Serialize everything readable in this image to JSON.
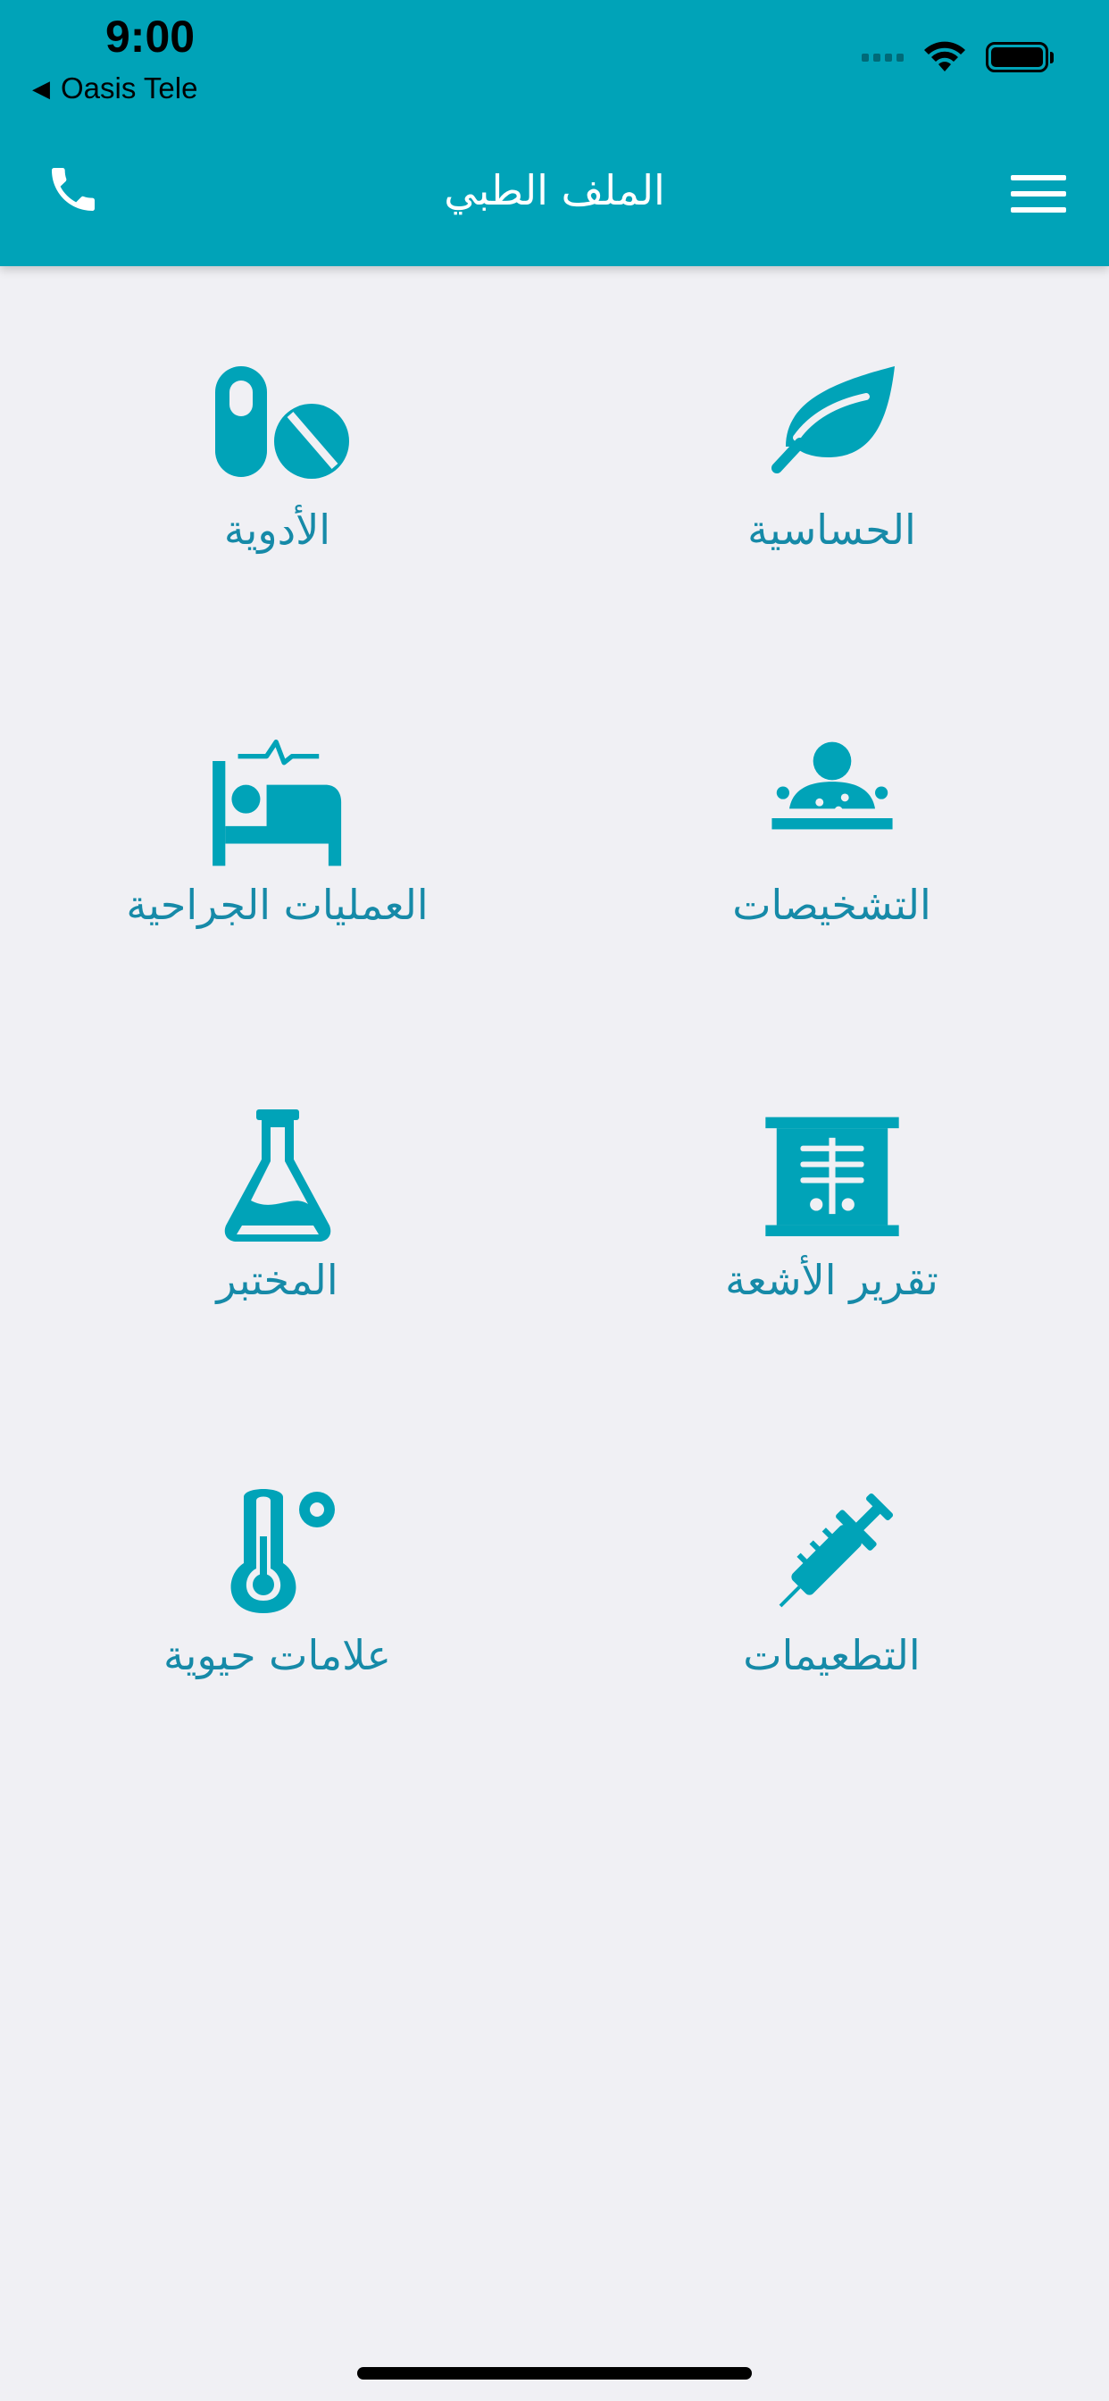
{
  "status_bar": {
    "time": "9:00",
    "back_label": "Oasis Tele"
  },
  "header": {
    "title": "الملف الطبي"
  },
  "grid": {
    "items": [
      {
        "label": "الحساسية",
        "icon": "leaf-icon"
      },
      {
        "label": "الأدوية",
        "icon": "pills-icon"
      },
      {
        "label": "التشخيصات",
        "icon": "diagnosis-icon"
      },
      {
        "label": "العمليات الجراحية",
        "icon": "hospital-bed-icon"
      },
      {
        "label": "تقرير الأشعة",
        "icon": "xray-icon"
      },
      {
        "label": "المختبر",
        "icon": "flask-icon"
      },
      {
        "label": "التطعيمات",
        "icon": "syringe-icon"
      },
      {
        "label": "علامات حيوية",
        "icon": "thermometer-icon"
      }
    ]
  },
  "colors": {
    "header": "#00a3b8",
    "icon": "#00a3b8",
    "label": "#168aa8",
    "background": "#f0f0f4"
  }
}
